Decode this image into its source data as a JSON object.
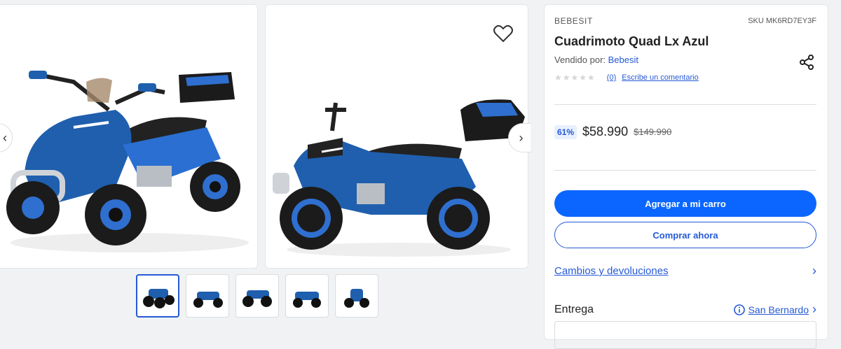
{
  "product": {
    "brand": "BEBESIT",
    "sku": "SKU MK6RD7EY3F",
    "title": "Cuadrimoto Quad Lx Azul",
    "sold_by_label": "Vendido por:",
    "seller": "Bebesit",
    "review_count": "(0)",
    "write_review": "Escribe un comentario",
    "stars": "★★★★★",
    "rating": 0,
    "discount": "61%",
    "price": "$58.990",
    "old_price": "$149.990"
  },
  "actions": {
    "add_to_cart": "Agregar a mi carro",
    "buy_now": "Comprar ahora"
  },
  "returns": {
    "label": "Cambios y devoluciones"
  },
  "delivery": {
    "title": "Entrega",
    "location": "San Bernardo"
  },
  "gallery": {
    "thumbnails": 5,
    "active_thumbnail": 1
  },
  "colors": {
    "accent": "#0b66ff",
    "link": "#2559d6",
    "quad_blue": "#1f5fae"
  },
  "icons": [
    "chevron-left-icon",
    "chevron-right-icon",
    "heart-icon",
    "share-icon",
    "info-icon"
  ]
}
